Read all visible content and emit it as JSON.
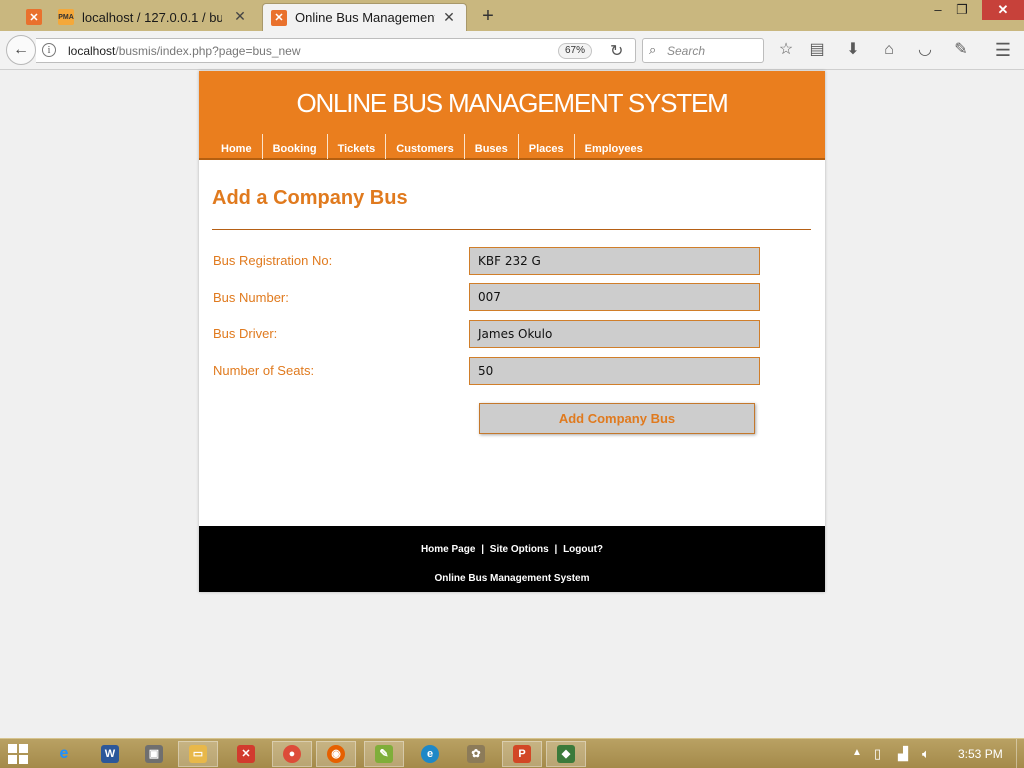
{
  "browser": {
    "tabs": [
      {
        "title": "localhost / 127.0.0.1 / bus...",
        "favicon": "phpmyadmin-icon"
      },
      {
        "title": "Online Bus Management ...",
        "favicon": "xampp-icon"
      }
    ],
    "address": {
      "host": "localhost",
      "path": "/busmis/index.php?page=bus_new"
    },
    "zoom": "67%",
    "search_placeholder": "Search"
  },
  "site": {
    "title": "ONLINE BUS MANAGEMENT SYSTEM",
    "nav": [
      "Home",
      "Booking",
      "Tickets",
      "Customers",
      "Buses",
      "Places",
      "Employees"
    ],
    "accent_color": "#ea7e1e"
  },
  "form": {
    "heading": "Add a Company Bus",
    "fields": [
      {
        "label": "Bus Registration No:",
        "value": "KBF 232 G"
      },
      {
        "label": "Bus Number:",
        "value": "007"
      },
      {
        "label": "Bus Driver:",
        "value": "James Okulo"
      },
      {
        "label": "Number of Seats:",
        "value": "50"
      }
    ],
    "submit_label": "Add Company Bus"
  },
  "footer": {
    "links": [
      "Home Page",
      "Site Options",
      "Logout?"
    ],
    "separator": "|",
    "copy": "Online Bus Management System"
  },
  "taskbar": {
    "clock": "3:53 PM"
  }
}
